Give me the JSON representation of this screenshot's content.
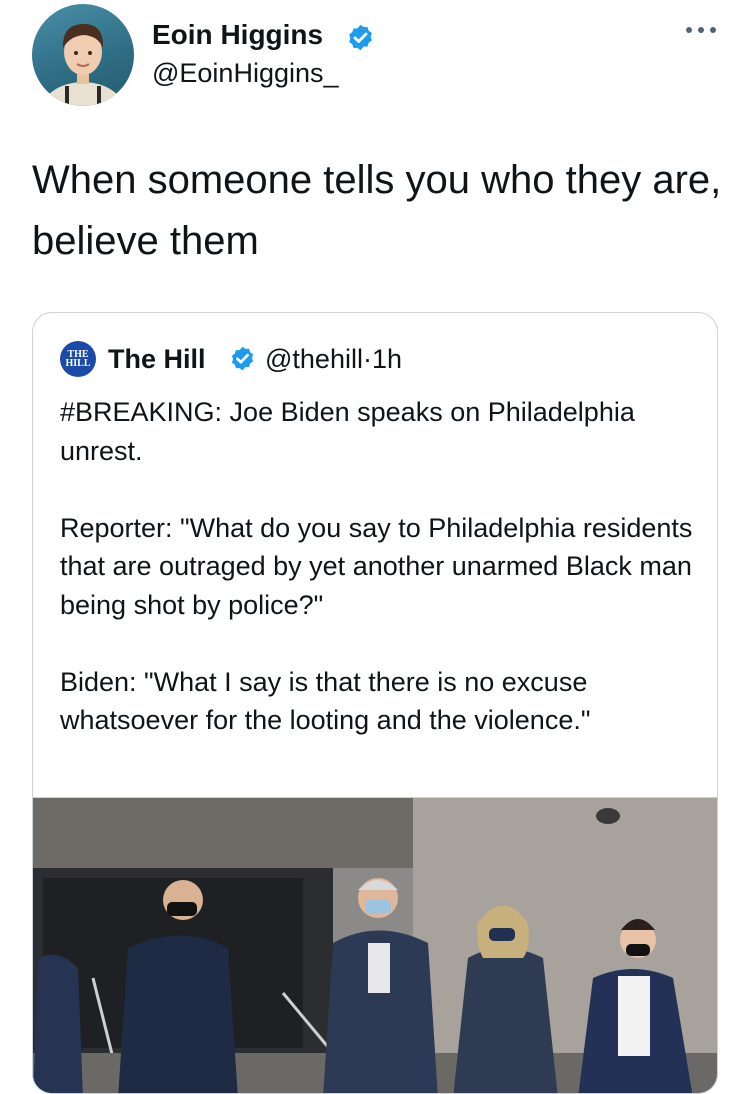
{
  "author": {
    "name": "Eoin Higgins",
    "handle": "@EoinHiggins_",
    "avatar_icon": "profile-photo",
    "verified_icon": "verified-badge-icon"
  },
  "menu_icon": "more-options-icon",
  "tweet": {
    "text": "When someone tells you who they are, believe them"
  },
  "quoted": {
    "logo_text": "THE HILL",
    "name": "The Hill",
    "handle": "@thehill",
    "separator": "·",
    "time": "1h",
    "paragraphs": [
      "#BREAKING: Joe Biden speaks on Philadelphia unrest.",
      "Reporter: \"What do you say to Philadelphia residents that are outraged by yet another unarmed Black man being shot by police?\"",
      "Biden: \"What I say is that there is no excuse whatsoever for the looting and the violence.\""
    ],
    "media_icon": "video-still-image"
  },
  "colors": {
    "text": "#0f1419",
    "verified": "#1d9bf0",
    "border": "#c9d3dc",
    "hill_blue": "#1c4aa8"
  }
}
